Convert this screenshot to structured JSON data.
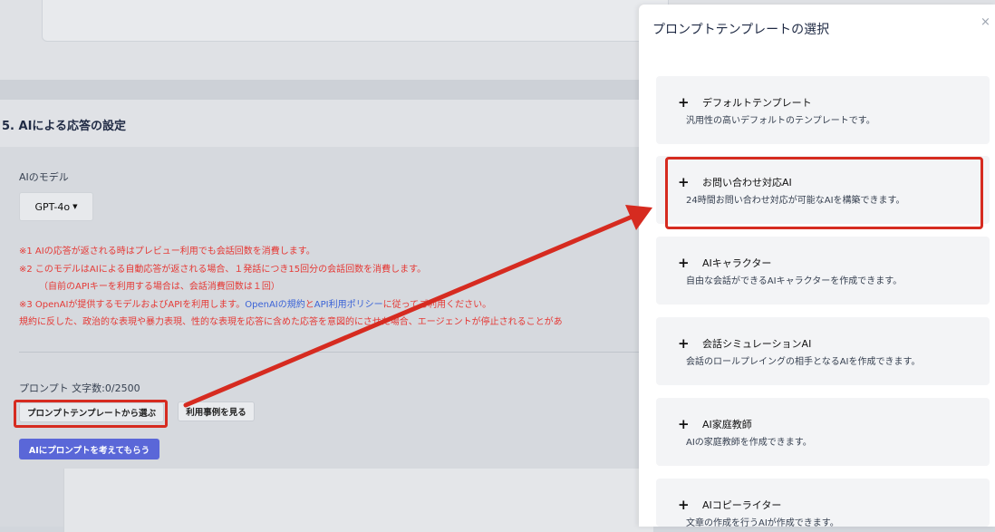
{
  "background": {
    "section_title": "5. AIによる応答の設定",
    "model_label": "AIのモデル",
    "model_value": "GPT-4o",
    "notes": [
      "※1 AIの応答が返される時はプレビュー利用でも会話回数を消費します。",
      "※2 このモデルはAIによる自動応答が返される場合、１発話につき15回分の会話回数を消費します。",
      "（自前のAPIキーを利用する場合は、会話消費回数は１回）",
      "※3 OpenAIが提供するモデルおよびAPIを利用します。",
      "OpenAIの規約",
      "と",
      "API利用ポリシー",
      "に従ってご利用ください。",
      "規約に反した、政治的な表現や暴力表現、性的な表現を応答に含めた応答を意図的にさせた場合、エージェントが停止されることがあ"
    ],
    "prompt_label": "プロンプト 文字数:0/2500",
    "template_button": "プロンプトテンプレートから選ぶ",
    "example_button": "利用事例を見る",
    "ai_prompt_button": "AIにプロンプトを考えてもらう"
  },
  "modal": {
    "title": "プロンプトテンプレートの選択",
    "close": "×",
    "templates": [
      {
        "name": "デフォルトテンプレート",
        "desc": "汎用性の高いデフォルトのテンプレートです。"
      },
      {
        "name": "お問い合わせ対応AI",
        "desc": "24時間お問い合わせ対応が可能なAIを構築できます。"
      },
      {
        "name": "AIキャラクター",
        "desc": "自由な会話ができるAIキャラクターを作成できます。"
      },
      {
        "name": "会話シミュレーションAI",
        "desc": "会話のロールプレイングの相手となるAIを作成できます。"
      },
      {
        "name": "AI家庭教師",
        "desc": "AIの家庭教師を作成できます。"
      },
      {
        "name": "AIコピーライター",
        "desc": "文章の作成を行うAIが作成できます。"
      }
    ]
  },
  "colors": {
    "annotation_red": "#d62b20",
    "note_red": "#e53935",
    "link_blue": "#3b63d6",
    "primary_button": "#5a67d8"
  },
  "icons": {
    "plus": "plus-icon",
    "caret": "caret-down-icon",
    "close": "close-icon"
  }
}
